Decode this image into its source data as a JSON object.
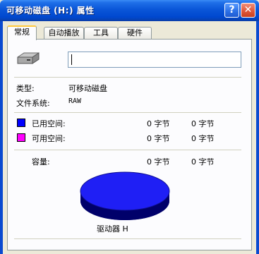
{
  "window": {
    "title": "可移动磁盘 (H:) 属性",
    "help_button": "?",
    "close_button": "✕"
  },
  "tabs": [
    {
      "label": "常规",
      "active": true
    },
    {
      "label": "自动播放",
      "active": false
    },
    {
      "label": "工具",
      "active": false
    },
    {
      "label": "硬件",
      "active": false
    }
  ],
  "general": {
    "drive_name_value": "",
    "type_label": "类型:",
    "type_value": "可移动磁盘",
    "fs_label": "文件系统:",
    "fs_value": "RAW",
    "used_label": "已用空间:",
    "used_bytes": "0 字节",
    "used_size": "0 字节",
    "free_label": "可用空间:",
    "free_bytes": "0 字节",
    "free_size": "0 字节",
    "capacity_label": "容量:",
    "capacity_bytes": "0 字节",
    "capacity_size": "0 字节",
    "drive_caption": "驱动器 H"
  },
  "colors": {
    "used": "#0000ff",
    "free": "#ff00ff",
    "pie_top": "#1f1ff5",
    "pie_side": "#000080"
  },
  "icons": {
    "drive": "removable-drive-icon"
  }
}
